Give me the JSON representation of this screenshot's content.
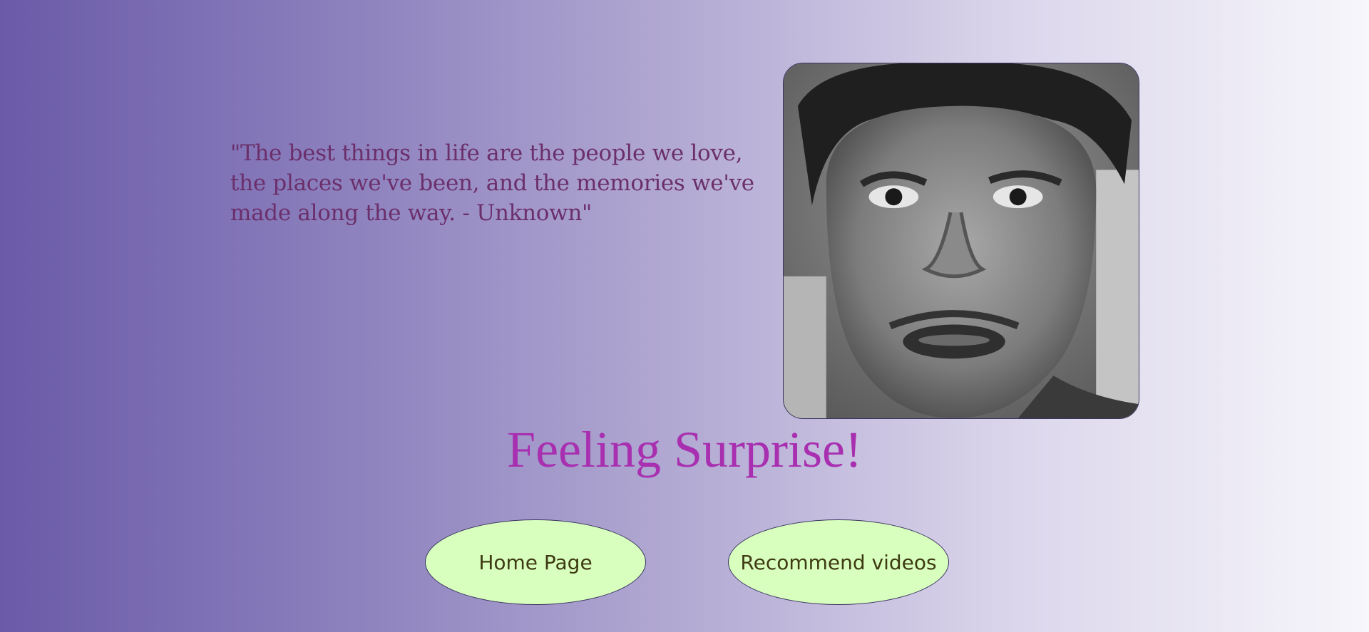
{
  "quote": {
    "text": "\"The best things in life are the people we love, the places we've been, and the memories we've made along the way. - Unknown\""
  },
  "photo": {
    "icon": "webcam-face-photo"
  },
  "emotion": {
    "label": "Feeling Surprise!"
  },
  "buttons": {
    "home_label": "Home Page",
    "recommend_label": "Recommend videos"
  },
  "colors": {
    "gradient_start": "#6a5aa8",
    "gradient_end": "#f7f6fb",
    "quote_text": "#6b2f6b",
    "emotion_text": "#a830b0",
    "button_bg": "#d9ffbf",
    "button_text": "#3d3a12"
  }
}
